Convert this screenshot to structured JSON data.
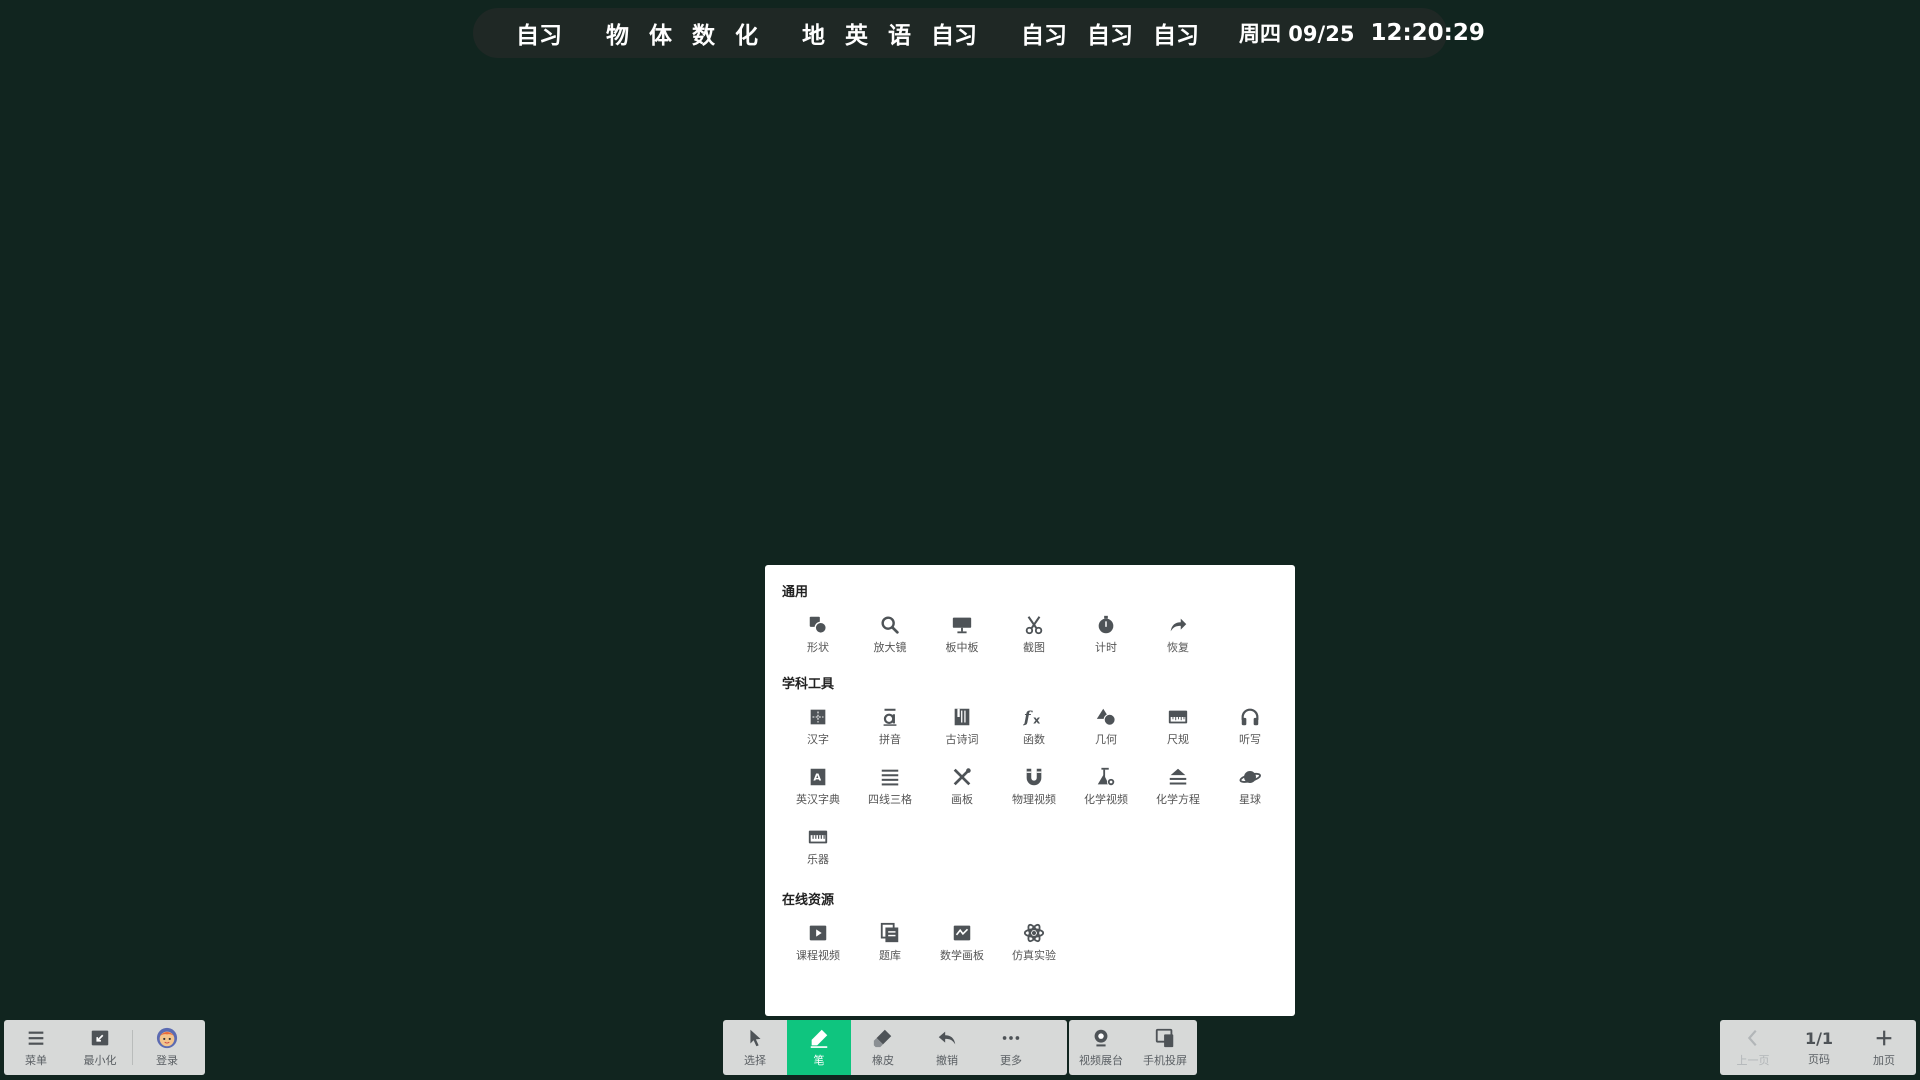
{
  "schedule": {
    "groups": [
      [
        "自习"
      ],
      [
        "物",
        "体",
        "数",
        "化"
      ],
      [
        "地",
        "英",
        "语",
        "自习"
      ],
      [
        "自习",
        "自习",
        "自习"
      ]
    ],
    "date": "周四 09/25",
    "time": "12:20:29"
  },
  "tools_panel": {
    "sections": [
      {
        "title": "通用",
        "items": [
          {
            "label": "形状",
            "icon": "shapes-icon"
          },
          {
            "label": "放大镜",
            "icon": "magnifier-icon"
          },
          {
            "label": "板中板",
            "icon": "board-in-board-icon"
          },
          {
            "label": "截图",
            "icon": "scissors-icon"
          },
          {
            "label": "计时",
            "icon": "timer-icon"
          },
          {
            "label": "恢复",
            "icon": "restore-icon"
          }
        ]
      },
      {
        "title": "学科工具",
        "items": [
          {
            "label": "汉字",
            "icon": "hanzi-grid-icon"
          },
          {
            "label": "拼音",
            "icon": "pinyin-icon"
          },
          {
            "label": "古诗词",
            "icon": "poetry-book-icon"
          },
          {
            "label": "函数",
            "icon": "function-icon"
          },
          {
            "label": "几何",
            "icon": "geometry-icon"
          },
          {
            "label": "尺规",
            "icon": "ruler-icon"
          },
          {
            "label": "听写",
            "icon": "headphones-icon"
          },
          {
            "label": "英汉字典",
            "icon": "dictionary-icon"
          },
          {
            "label": "四线三格",
            "icon": "four-lines-icon"
          },
          {
            "label": "画板",
            "icon": "drawing-board-icon"
          },
          {
            "label": "物理视频",
            "icon": "magnet-icon"
          },
          {
            "label": "化学视频",
            "icon": "flask-icon"
          },
          {
            "label": "化学方程",
            "icon": "equation-icon"
          },
          {
            "label": "星球",
            "icon": "planet-icon"
          },
          {
            "label": "乐器",
            "icon": "piano-icon"
          }
        ]
      },
      {
        "title": "在线资源",
        "items": [
          {
            "label": "课程视频",
            "icon": "video-play-icon"
          },
          {
            "label": "题库",
            "icon": "question-bank-icon"
          },
          {
            "label": "数学画板",
            "icon": "math-board-icon"
          },
          {
            "label": "仿真实验",
            "icon": "atom-icon"
          }
        ]
      }
    ]
  },
  "left_toolbar": {
    "menu": "菜单",
    "minimize": "最小化",
    "login": "登录"
  },
  "center_toolbar": {
    "select": "选择",
    "pen": "笔",
    "eraser": "橡皮",
    "undo": "撤销",
    "more": "更多",
    "video_booth": "视频展台",
    "phone_cast": "手机投屏"
  },
  "right_toolbar": {
    "prev_page": "上一页",
    "page_number": "1/1",
    "page_label": "页码",
    "add_page": "加页"
  },
  "colors": {
    "background": "#11251f",
    "accent": "#0fc57f",
    "icon": "#4e5357"
  }
}
